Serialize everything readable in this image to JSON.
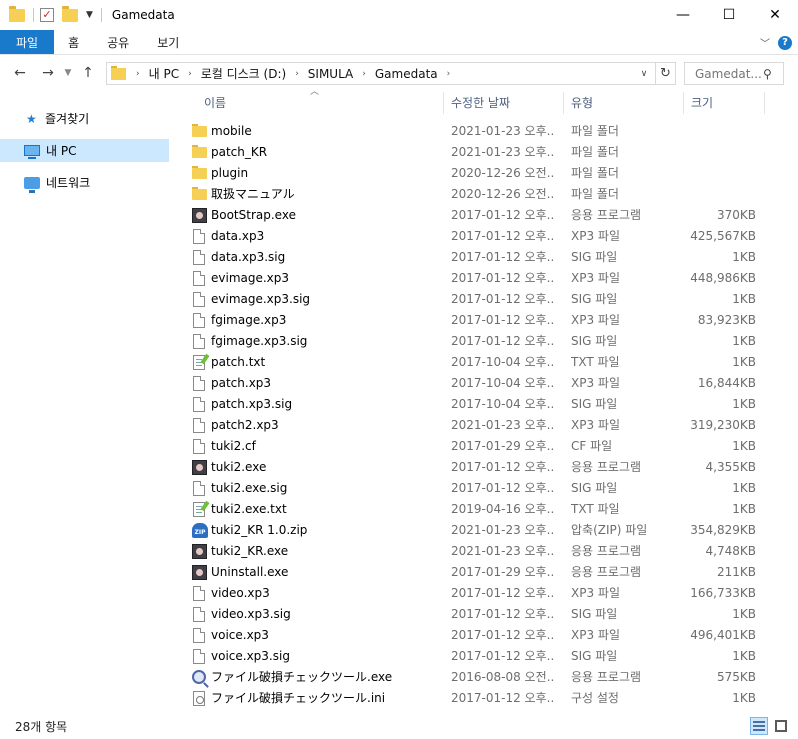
{
  "window": {
    "title": "Gamedata",
    "minimize": "—",
    "maximize": "☐",
    "close": "✕"
  },
  "ribbon": {
    "tabs": [
      "파일",
      "홈",
      "공유",
      "보기"
    ],
    "active_tab_color": "#1979ca"
  },
  "address": {
    "crumbs": [
      "내 PC",
      "로컬 디스크 (D:)",
      "SIMULA",
      "Gamedata"
    ],
    "search_placeholder": "Gamedat..."
  },
  "sidebar": {
    "items": [
      {
        "label": "즐겨찾기",
        "icon": "star-icon"
      },
      {
        "label": "내 PC",
        "icon": "computer-icon",
        "selected": true
      },
      {
        "label": "네트워크",
        "icon": "network-icon"
      }
    ]
  },
  "columns": {
    "name": "이름",
    "date": "수정한 날짜",
    "type": "유형",
    "size": "크기"
  },
  "files": [
    {
      "name": "mobile",
      "date": "2021-01-23 오후...",
      "type": "파일 폴더",
      "size": "",
      "icon": "folder-icon"
    },
    {
      "name": "patch_KR",
      "date": "2021-01-23 오후...",
      "type": "파일 폴더",
      "size": "",
      "icon": "folder-icon"
    },
    {
      "name": "plugin",
      "date": "2020-12-26 오전...",
      "type": "파일 폴더",
      "size": "",
      "icon": "folder-icon"
    },
    {
      "name": "取扱マニュアル",
      "date": "2020-12-26 오전...",
      "type": "파일 폴더",
      "size": "",
      "icon": "folder-icon"
    },
    {
      "name": "BootStrap.exe",
      "date": "2017-01-12 오후...",
      "type": "응용 프로그램",
      "size": "370KB",
      "icon": "app-icon"
    },
    {
      "name": "data.xp3",
      "date": "2017-01-12 오후...",
      "type": "XP3 파일",
      "size": "425,567KB",
      "icon": "file-icon"
    },
    {
      "name": "data.xp3.sig",
      "date": "2017-01-12 오후...",
      "type": "SIG 파일",
      "size": "1KB",
      "icon": "file-icon"
    },
    {
      "name": "evimage.xp3",
      "date": "2017-01-12 오후...",
      "type": "XP3 파일",
      "size": "448,986KB",
      "icon": "file-icon"
    },
    {
      "name": "evimage.xp3.sig",
      "date": "2017-01-12 오후...",
      "type": "SIG 파일",
      "size": "1KB",
      "icon": "file-icon"
    },
    {
      "name": "fgimage.xp3",
      "date": "2017-01-12 오후...",
      "type": "XP3 파일",
      "size": "83,923KB",
      "icon": "file-icon"
    },
    {
      "name": "fgimage.xp3.sig",
      "date": "2017-01-12 오후...",
      "type": "SIG 파일",
      "size": "1KB",
      "icon": "file-icon"
    },
    {
      "name": "patch.txt",
      "date": "2017-10-04 오후...",
      "type": "TXT 파일",
      "size": "1KB",
      "icon": "text-file-icon"
    },
    {
      "name": "patch.xp3",
      "date": "2017-10-04 오후...",
      "type": "XP3 파일",
      "size": "16,844KB",
      "icon": "file-icon"
    },
    {
      "name": "patch.xp3.sig",
      "date": "2017-10-04 오후...",
      "type": "SIG 파일",
      "size": "1KB",
      "icon": "file-icon"
    },
    {
      "name": "patch2.xp3",
      "date": "2021-01-23 오후...",
      "type": "XP3 파일",
      "size": "319,230KB",
      "icon": "file-icon"
    },
    {
      "name": "tuki2.cf",
      "date": "2017-01-29 오후...",
      "type": "CF 파일",
      "size": "1KB",
      "icon": "file-icon"
    },
    {
      "name": "tuki2.exe",
      "date": "2017-01-12 오후...",
      "type": "응용 프로그램",
      "size": "4,355KB",
      "icon": "app-icon"
    },
    {
      "name": "tuki2.exe.sig",
      "date": "2017-01-12 오후...",
      "type": "SIG 파일",
      "size": "1KB",
      "icon": "file-icon"
    },
    {
      "name": "tuki2.exe.txt",
      "date": "2019-04-16 오후...",
      "type": "TXT 파일",
      "size": "1KB",
      "icon": "text-file-icon"
    },
    {
      "name": "tuki2_KR 1.0.zip",
      "date": "2021-01-23 오후...",
      "type": "압축(ZIP) 파일",
      "size": "354,829KB",
      "icon": "zip-icon"
    },
    {
      "name": "tuki2_KR.exe",
      "date": "2021-01-23 오후...",
      "type": "응용 프로그램",
      "size": "4,748KB",
      "icon": "app-icon"
    },
    {
      "name": "Uninstall.exe",
      "date": "2017-01-29 오후...",
      "type": "응용 프로그램",
      "size": "211KB",
      "icon": "app-icon"
    },
    {
      "name": "video.xp3",
      "date": "2017-01-12 오후...",
      "type": "XP3 파일",
      "size": "166,733KB",
      "icon": "file-icon"
    },
    {
      "name": "video.xp3.sig",
      "date": "2017-01-12 오후...",
      "type": "SIG 파일",
      "size": "1KB",
      "icon": "file-icon"
    },
    {
      "name": "voice.xp3",
      "date": "2017-01-12 오후...",
      "type": "XP3 파일",
      "size": "496,401KB",
      "icon": "file-icon"
    },
    {
      "name": "voice.xp3.sig",
      "date": "2017-01-12 오후...",
      "type": "SIG 파일",
      "size": "1KB",
      "icon": "file-icon"
    },
    {
      "name": "ファイル破損チェックツール.exe",
      "date": "2016-08-08 오전...",
      "type": "응용 프로그램",
      "size": "575KB",
      "icon": "magnifier-app-icon"
    },
    {
      "name": "ファイル破損チェックツール.ini",
      "date": "2017-01-12 오후...",
      "type": "구성 설정",
      "size": "1KB",
      "icon": "settings-file-icon"
    }
  ],
  "status": {
    "count": "28개 항목"
  }
}
